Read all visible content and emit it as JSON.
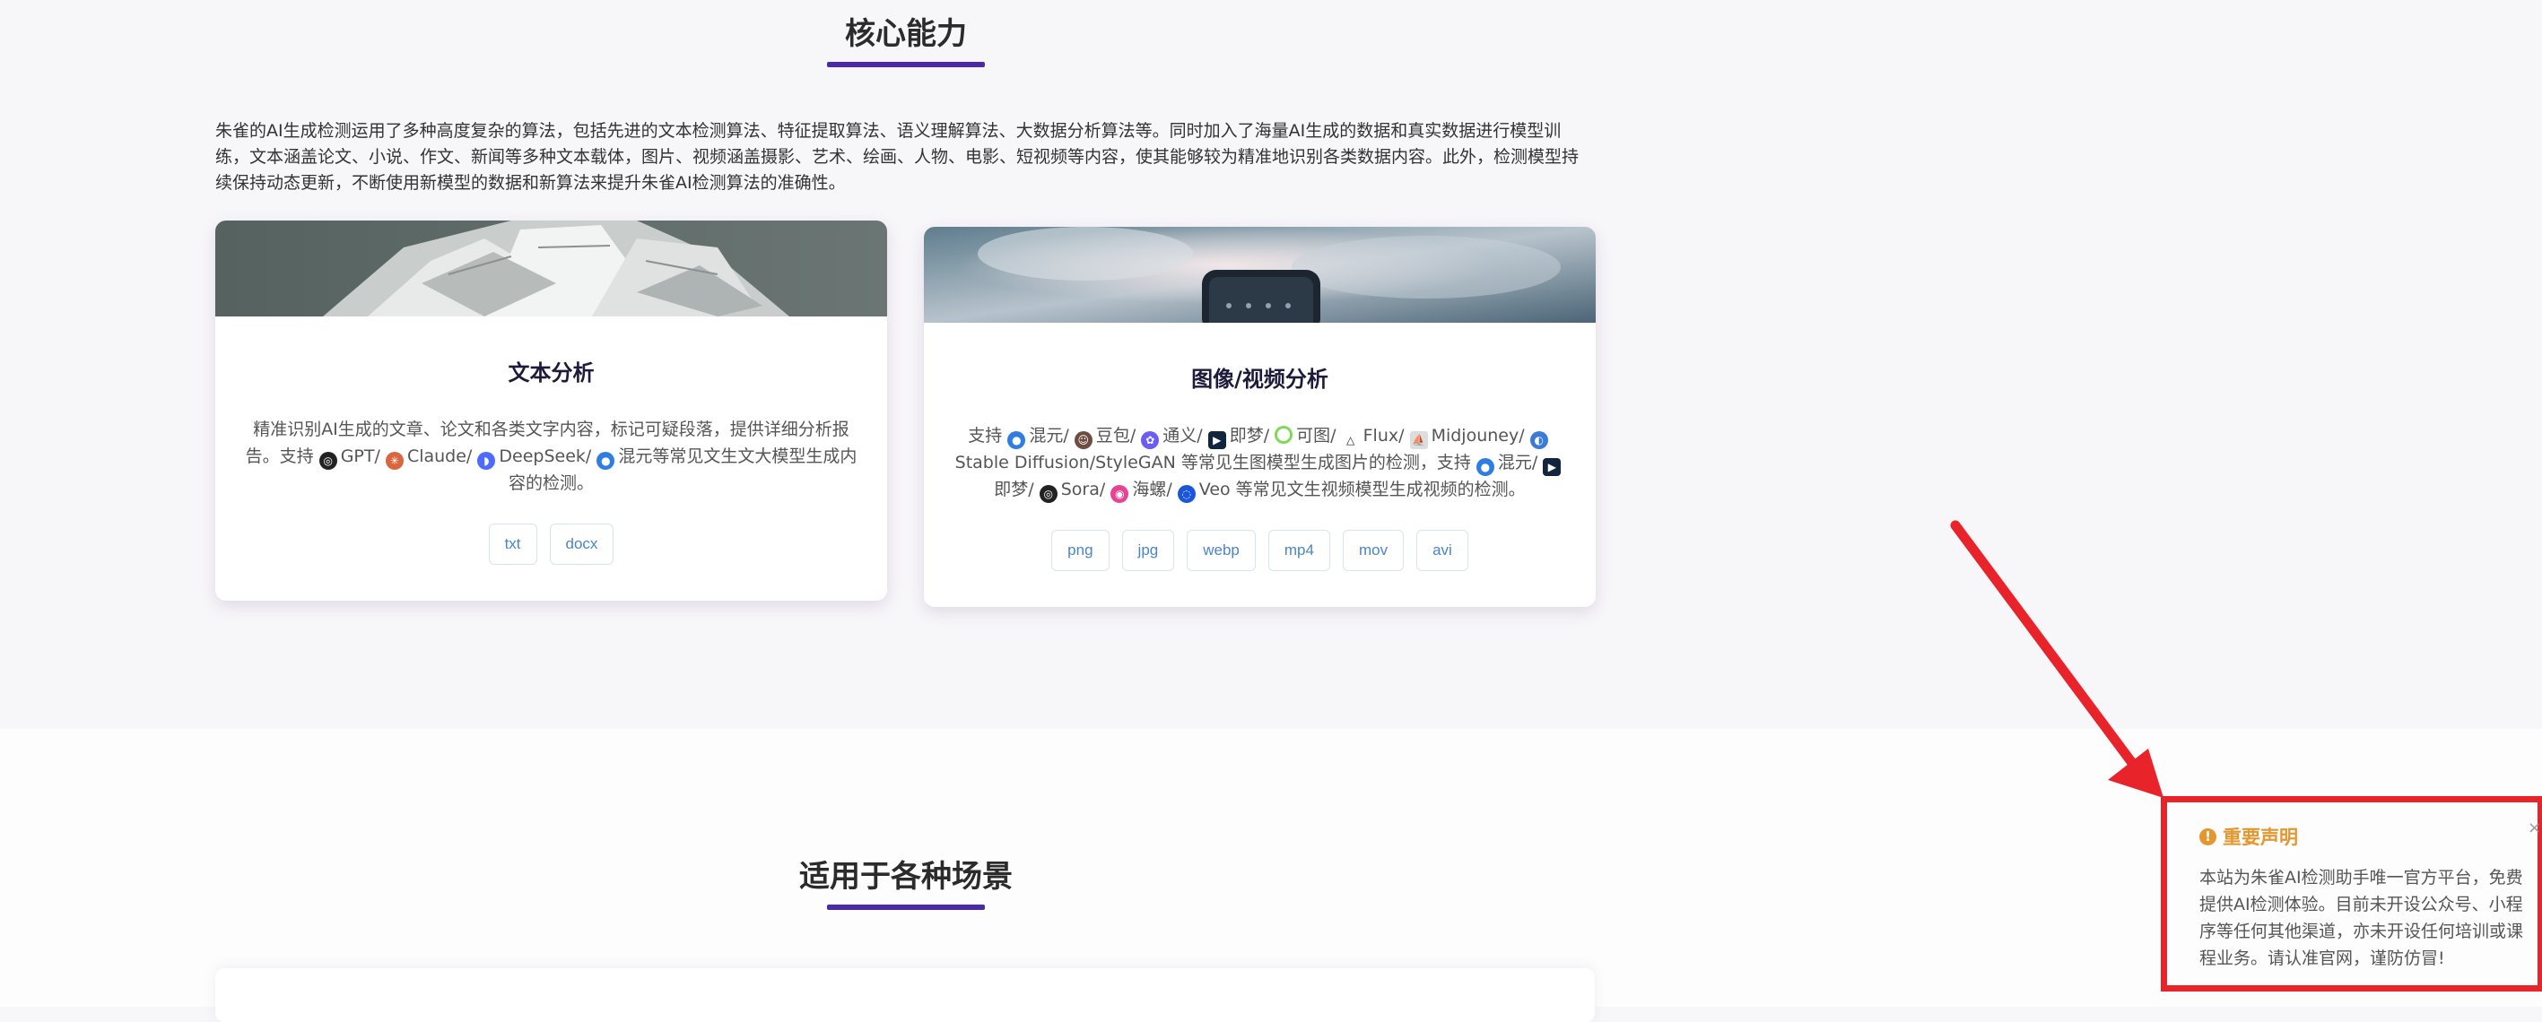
{
  "sections": {
    "core": {
      "title": "核心能力"
    },
    "scenes": {
      "title": "适用于各种场景"
    }
  },
  "intro": "朱雀的AI生成检测运用了多种高度复杂的算法，包括先进的文本检测算法、特征提取算法、语义理解算法、大数据分析算法等。同时加入了海量AI生成的数据和真实数据进行模型训练，文本涵盖论文、小说、作文、新闻等多种文本载体，图片、视频涵盖摄影、艺术、绘画、人物、电影、短视频等内容，使其能够较为精准地识别各类数据内容。此外，检测模型持续保持动态更新，不断使用新模型的数据和新算法来提升朱雀AI检测算法的准确性。",
  "cards": {
    "text": {
      "title": "文本分析",
      "desc_prefix": "精准识别AI生成的文章、论文和各类文字内容，标记可疑段落，提供详细分析报告。支持",
      "models": [
        "GPT/",
        "Claude/",
        "DeepSeek/",
        "混元等常见文生文大模型生成内容的检测。"
      ],
      "tags": [
        "txt",
        "docx"
      ]
    },
    "image": {
      "title": "图像/视频分析",
      "desc_prefix": "支持",
      "image_models": [
        "混元/",
        "豆包/",
        "通义/",
        "即梦/",
        "可图/",
        "Flux/",
        "Midjouney/"
      ],
      "image_suffix": "Stable Diffusion/StyleGAN 等常见生图模型生成图片的检测，支持",
      "video_models": [
        "混元/",
        "即梦/",
        "Sora/",
        "海螺/",
        "Veo 等常见文生视频模型生成视频的检测。"
      ],
      "tags": [
        "png",
        "jpg",
        "webp",
        "mp4",
        "mov",
        "avi"
      ]
    }
  },
  "notice": {
    "title": "重要声明",
    "body": "本站为朱雀AI检测助手唯一官方平台，免费提供AI检测体验。目前未开设公众号、小程序等任何其他渠道，亦未开设任何培训或课程业务。请认准官网，谨防仿冒!",
    "close": "×"
  },
  "colors": {
    "accent_underline": "#4a2aa8",
    "notice_title": "#e4972f",
    "annotation": "#e8232a",
    "tag_text": "#4a86c5"
  }
}
